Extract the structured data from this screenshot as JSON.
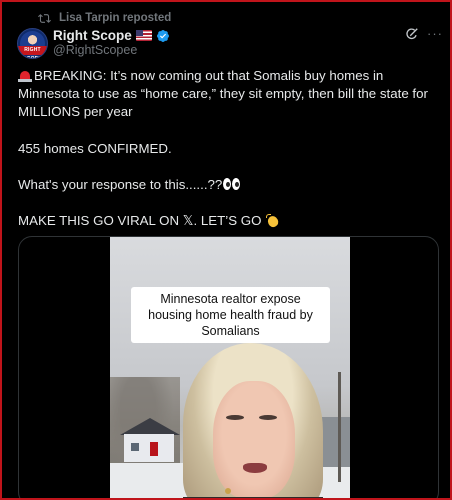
{
  "repost": {
    "icon": "repost-icon",
    "text": "Lisa Tarpin reposted"
  },
  "author": {
    "display_name": "Right Scope",
    "handle": "@RightScopee",
    "avatar_text": "RIGHT SCOPE",
    "badges": [
      "us-flag-icon",
      "verified-badge-icon"
    ]
  },
  "actions": {
    "grok_icon": "grok-icon",
    "more_icon": "more-icon",
    "more_glyph": "···"
  },
  "post": {
    "line1": "BREAKING: It’s now coming out that Somalis buy homes in Minnesota to use as “home care,” they sit empty, then bill the state for MILLIONS per year",
    "line2": "455 homes CONFIRMED.",
    "line3": "What's your response to this......??",
    "line4": "MAKE THIS GO VIRAL ON 𝕏. LET’S GO"
  },
  "media": {
    "type": "video",
    "caption": "Minnesota realtor expose housing home health fraud by Somalians"
  },
  "colors": {
    "background": "#000000",
    "text": "#e7e9ea",
    "muted": "#71767b",
    "verified": "#1d9bf0",
    "frame": "#c0141b"
  }
}
